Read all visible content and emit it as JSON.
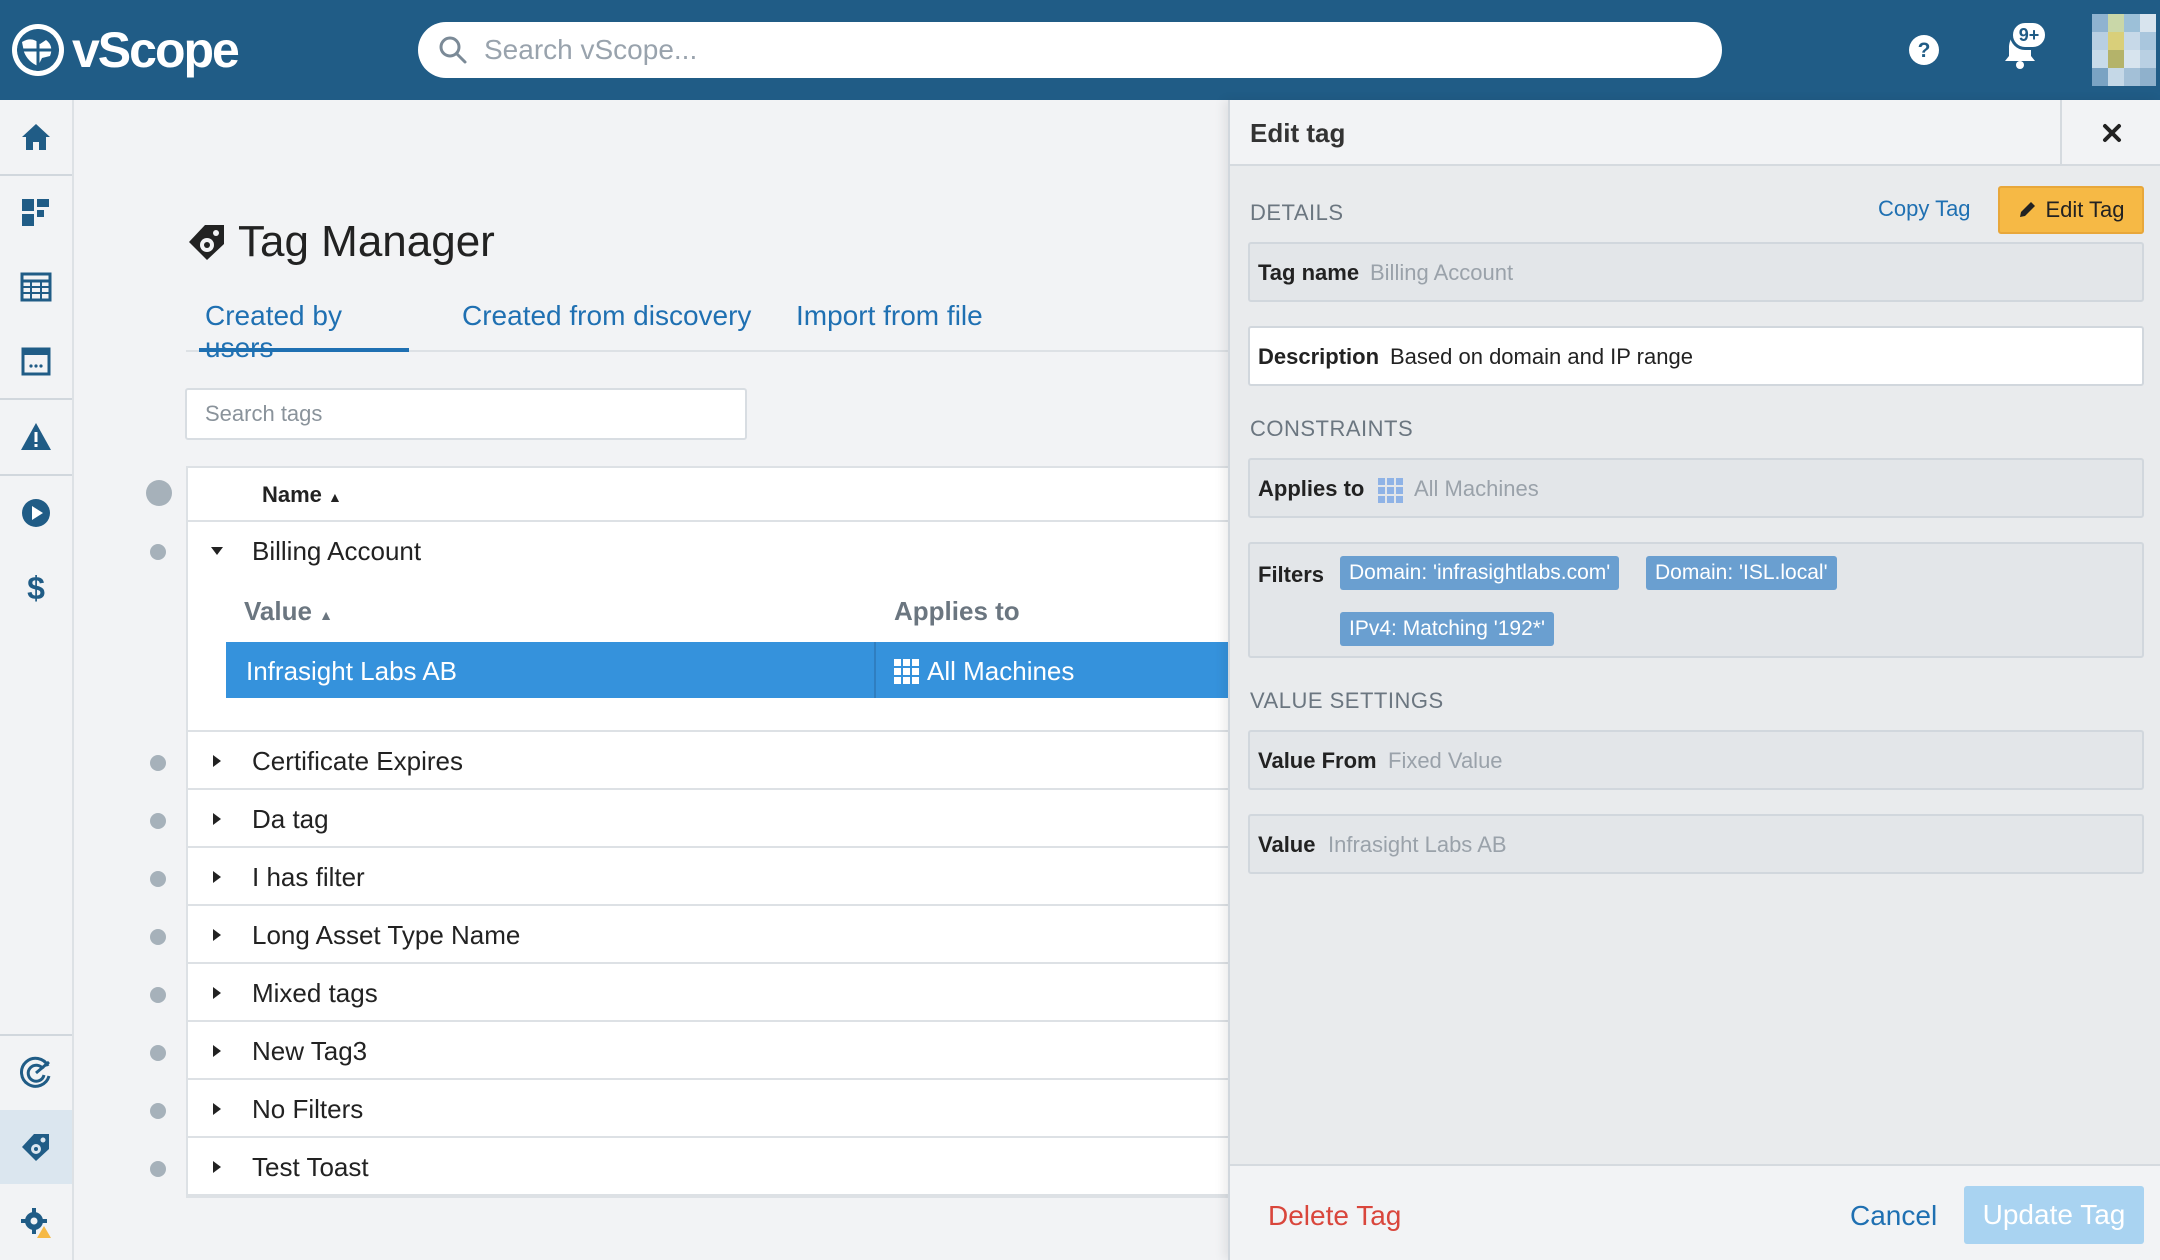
{
  "app": {
    "name": "vScope"
  },
  "search": {
    "placeholder": "Search vScope..."
  },
  "notifications": {
    "badge": "9+"
  },
  "page": {
    "title": "Tag Manager"
  },
  "tabs": [
    {
      "label": "Created by users"
    },
    {
      "label": "Created from discovery"
    },
    {
      "label": "Import from file"
    }
  ],
  "tag_search": {
    "placeholder": "Search tags"
  },
  "table": {
    "header_name": "Name",
    "rows": [
      {
        "label": "Billing Account"
      },
      {
        "label": "Certificate Expires"
      },
      {
        "label": "Da tag"
      },
      {
        "label": "I has filter"
      },
      {
        "label": "Long Asset Type Name"
      },
      {
        "label": "Mixed tags"
      },
      {
        "label": "New Tag3"
      },
      {
        "label": "No Filters"
      },
      {
        "label": "Test Toast"
      }
    ],
    "subtable": {
      "header_value": "Value",
      "header_applies": "Applies to",
      "row": {
        "value": "Infrasight Labs AB",
        "applies_to": "All Machines"
      }
    }
  },
  "panel": {
    "title": "Edit tag",
    "details_label": "DETAILS",
    "copy_tag": "Copy Tag",
    "edit_tag": "Edit Tag",
    "tag_name_key": "Tag name",
    "tag_name_value": "Billing Account",
    "description_key": "Description",
    "description_value": "Based on domain and IP range",
    "constraints_label": "CONSTRAINTS",
    "applies_to_key": "Applies to",
    "applies_to_value": "All Machines",
    "filters_key": "Filters",
    "filters": [
      "Domain: 'infrasightlabs.com'",
      "Domain: 'ISL.local'",
      "IPv4: Matching '192*'"
    ],
    "value_settings_label": "VALUE SETTINGS",
    "value_from_key": "Value From",
    "value_from_value": "Fixed Value",
    "value_key": "Value",
    "value_value": "Infrasight Labs AB",
    "delete": "Delete Tag",
    "cancel": "Cancel",
    "update": "Update Tag"
  },
  "colors": {
    "topbar": "#205c86",
    "accent": "#1f70b2",
    "selected_row": "#3592dc",
    "edit_button": "#f6b945",
    "delete": "#d9463c",
    "filter_chip": "#6a9fd0"
  }
}
